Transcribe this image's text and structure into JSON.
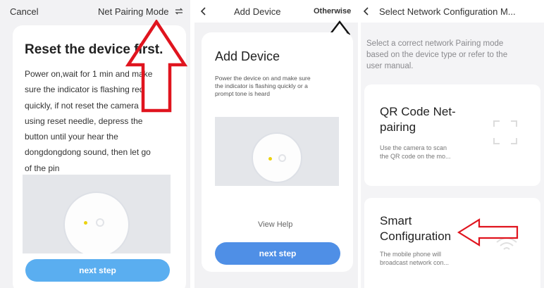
{
  "panel1": {
    "cancel_label": "Cancel",
    "mode_label": "Net Pairing Mode",
    "mode_icon": "swap-icon",
    "heading": "Reset the device first.",
    "instructions": [
      "Power on,wait for 1 min and make",
      "sure the indicator is flashing red",
      "quickly, if not reset the camera",
      "using reset needle, depress the",
      "button until your hear the",
      "dongdongdong sound, then let go",
      "of the pin"
    ],
    "next_label": "next step"
  },
  "panel2": {
    "back_icon": "chevron-left-icon",
    "title": "Add Device",
    "otherwise_label": "Otherwise",
    "heading": "Add Device",
    "instructions": [
      "Power the device on and make sure",
      "the indicator is flashing quickly or a",
      "prompt tone is heard"
    ],
    "view_help_label": "View Help",
    "next_label": "next step"
  },
  "panel3": {
    "back_icon": "chevron-left-icon",
    "title": "Select Network Configuration M...",
    "intro": [
      "Select a correct network Pairing mode",
      "based on the device type or refer to the",
      "user manual."
    ],
    "options": [
      {
        "title_lines": [
          "QR Code Net-",
          "pairing"
        ],
        "desc_lines": [
          "Use the camera to scan",
          "the QR code on the mo..."
        ],
        "icon": "scan-frame-icon"
      },
      {
        "title_lines": [
          "Smart",
          "Configuration"
        ],
        "desc_lines": [
          "The mobile phone will",
          "broadcast network con..."
        ],
        "icon": "wifi-icon"
      }
    ]
  },
  "colors": {
    "accent_blue": "#4f8fe6",
    "button_light_blue": "#5aaef0",
    "annotation_red": "#e0141e",
    "indicator_yellow": "#ecd20f"
  }
}
